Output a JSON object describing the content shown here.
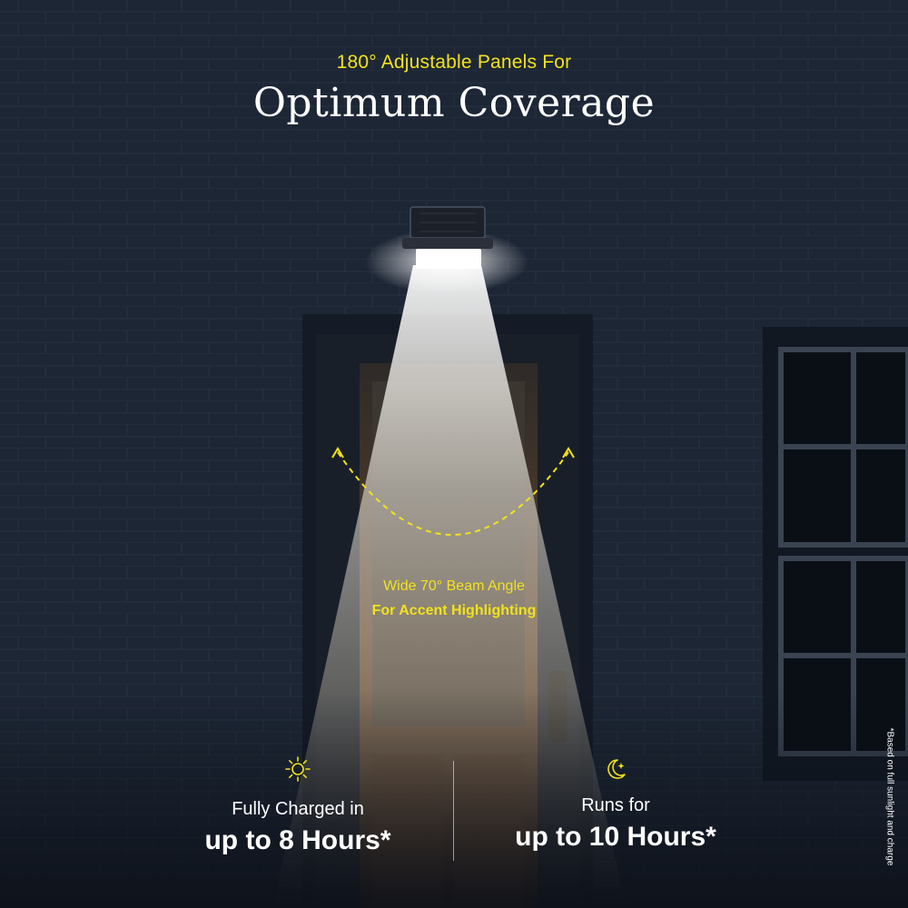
{
  "header": {
    "subtitle": "180° Adjustable Panels For",
    "headline": "Optimum  Coverage"
  },
  "beam": {
    "line1": "Wide 70° Beam Angle",
    "line2": "For Accent Highlighting"
  },
  "stats": [
    {
      "icon": "sun-icon",
      "line1": "Fully Charged in",
      "line2": "up to 8 Hours*"
    },
    {
      "icon": "moon-stars-icon",
      "line1": "Runs for",
      "line2": "up to 10 Hours*"
    }
  ],
  "disclaimer": "*Based on full sunlight and charge",
  "colors": {
    "accent_yellow": "#f2e21b",
    "text_white": "#ffffff",
    "night_wall": "#1c2533",
    "door_wood": "#6b4a2c"
  }
}
